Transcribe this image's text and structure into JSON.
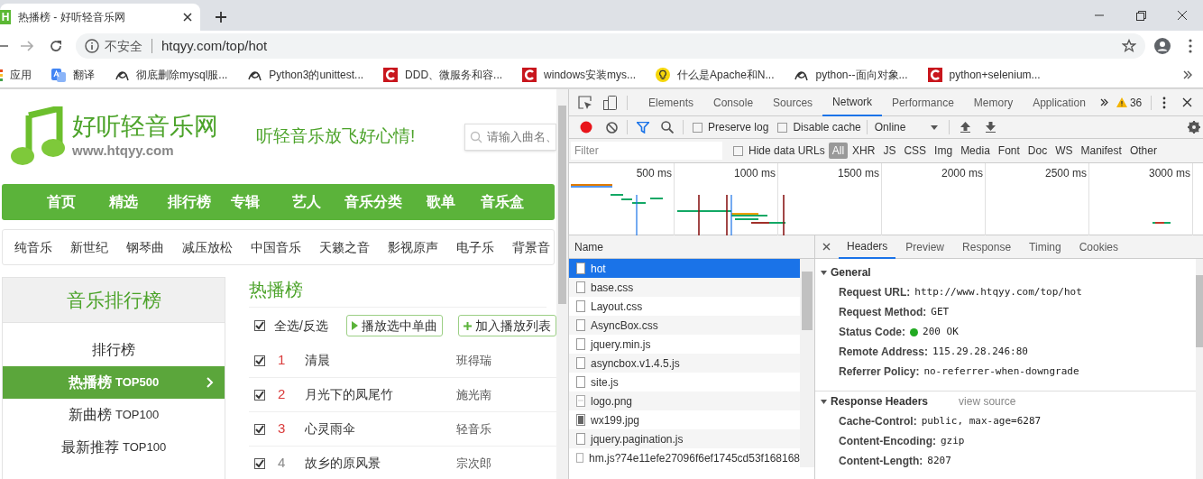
{
  "browser": {
    "tab": {
      "favicon": "H",
      "title": "热播榜 - 好听轻音乐网"
    },
    "address": {
      "security": "不安全",
      "url": "htqyy.com/top/hot"
    },
    "bookmarks": [
      {
        "kind": "apps",
        "label": "应用"
      },
      {
        "kind": "translate",
        "label": "翻译"
      },
      {
        "kind": "fish",
        "label": "彻底删除mysql服..."
      },
      {
        "kind": "fish",
        "label": "Python3的unittest..."
      },
      {
        "kind": "csdn",
        "label": "DDD、微服务和容..."
      },
      {
        "kind": "csdn",
        "label": "windows安装mys..."
      },
      {
        "kind": "bulb",
        "label": "什么是Apache和N..."
      },
      {
        "kind": "fish",
        "label": "python--面向对象..."
      },
      {
        "kind": "csdn",
        "label": "python+selenium..."
      }
    ]
  },
  "page": {
    "site_name": "好听轻音乐网",
    "domain": "www.htqyy.com",
    "slogan": "听轻音乐放飞好心情!",
    "search_placeholder": "请输入曲名、",
    "nav": [
      "首页",
      "精选",
      "排行榜",
      "专辑",
      "艺人",
      "音乐分类",
      "歌单",
      "音乐盒"
    ],
    "subnav": [
      "纯音乐",
      "新世纪",
      "钢琴曲",
      "减压放松",
      "中国音乐",
      "天籁之音",
      "影视原声",
      "电子乐",
      "背景音"
    ],
    "sidebar": {
      "title": "音乐排行榜",
      "items": [
        {
          "label": "排行榜",
          "selected": false
        },
        {
          "label": "热播榜",
          "suffix": "TOP500",
          "selected": true
        },
        {
          "label": "新曲榜",
          "suffix": "TOP100",
          "selected": false
        },
        {
          "label": "最新推荐",
          "suffix": "TOP100",
          "selected": false
        }
      ]
    },
    "content": {
      "heading": "热播榜",
      "select_all": {
        "label": "全选/反选",
        "checked": true
      },
      "buttons": [
        {
          "kind": "play",
          "label": "播放选中单曲"
        },
        {
          "kind": "add",
          "label": "加入播放列表"
        }
      ],
      "songs": [
        {
          "num": "1",
          "color": "#d93a3a",
          "title": "清晨",
          "artist": "班得瑞",
          "checked": true
        },
        {
          "num": "2",
          "color": "#d93a3a",
          "title": "月光下的凤尾竹",
          "artist": "施光南",
          "checked": true
        },
        {
          "num": "3",
          "color": "#d93a3a",
          "title": "心灵雨伞",
          "artist": "轻音乐",
          "checked": true
        },
        {
          "num": "4",
          "color": "#888888",
          "title": "故乡的原风景",
          "artist": "宗次郎",
          "checked": true
        }
      ]
    }
  },
  "devtools": {
    "tabs": [
      {
        "label": "Elements",
        "selected": false
      },
      {
        "label": "Console",
        "selected": false
      },
      {
        "label": "Sources",
        "selected": false
      },
      {
        "label": "Network",
        "selected": true
      },
      {
        "label": "Performance",
        "selected": false
      },
      {
        "label": "Memory",
        "selected": false
      },
      {
        "label": "Application",
        "selected": false
      }
    ],
    "warnings": "36",
    "toolbar": {
      "recording": true,
      "preserve_log": {
        "label": "Preserve log",
        "checked": false
      },
      "disable_cache": {
        "label": "Disable cache",
        "checked": false
      },
      "throttling": "Online"
    },
    "filter": {
      "placeholder": "Filter",
      "hide_data_urls": {
        "label": "Hide data URLs",
        "checked": false
      },
      "types": [
        {
          "label": "All",
          "selected": true
        },
        {
          "label": "XHR",
          "selected": false
        },
        {
          "label": "JS",
          "selected": false
        },
        {
          "label": "CSS",
          "selected": false
        },
        {
          "label": "Img",
          "selected": false
        },
        {
          "label": "Media",
          "selected": false
        },
        {
          "label": "Font",
          "selected": false
        },
        {
          "label": "Doc",
          "selected": false
        },
        {
          "label": "WS",
          "selected": false
        },
        {
          "label": "Manifest",
          "selected": false
        },
        {
          "label": "Other",
          "selected": false
        }
      ]
    },
    "timeline_ticks": [
      "500 ms",
      "1000 ms",
      "1500 ms",
      "2000 ms",
      "2500 ms",
      "3000 ms"
    ],
    "requests": {
      "column": "Name",
      "items": [
        {
          "name": "hot",
          "kind": "doc",
          "selected": true
        },
        {
          "name": "base.css",
          "kind": "doc",
          "selected": false
        },
        {
          "name": "Layout.css",
          "kind": "doc",
          "selected": false
        },
        {
          "name": "AsyncBox.css",
          "kind": "doc",
          "selected": false
        },
        {
          "name": "jquery.min.js",
          "kind": "doc",
          "selected": false
        },
        {
          "name": "asyncbox.v1.4.5.js",
          "kind": "doc",
          "selected": false
        },
        {
          "name": "site.js",
          "kind": "doc",
          "selected": false
        },
        {
          "name": "logo.png",
          "kind": "image",
          "selected": false
        },
        {
          "name": "wx199.jpg",
          "kind": "photo",
          "selected": false
        },
        {
          "name": "jquery.pagination.js",
          "kind": "doc",
          "selected": false
        },
        {
          "name": "hm.js?74e11efe27096f6ef1745cd53f168168",
          "kind": "doc",
          "selected": false
        }
      ]
    },
    "detail_tabs": [
      {
        "label": "Headers",
        "selected": true
      },
      {
        "label": "Preview",
        "selected": false
      },
      {
        "label": "Response",
        "selected": false
      },
      {
        "label": "Timing",
        "selected": false
      },
      {
        "label": "Cookies",
        "selected": false
      }
    ],
    "general": {
      "title": "General",
      "expanded": true,
      "rows": [
        {
          "key": "Request URL:",
          "value": "http://www.htqyy.com/top/hot"
        },
        {
          "key": "Request Method:",
          "value": "GET"
        },
        {
          "key": "Status Code:",
          "value": "200 OK",
          "color": "#22aa22"
        },
        {
          "key": "Remote Address:",
          "value": "115.29.28.246:80"
        },
        {
          "key": "Referrer Policy:",
          "value": "no-referrer-when-downgrade"
        }
      ]
    },
    "response_headers": {
      "title": "Response Headers",
      "expanded": true,
      "link": "view source",
      "rows": [
        {
          "key": "Cache-Control:",
          "value": "public, max-age=6287"
        },
        {
          "key": "Content-Encoding:",
          "value": "gzip"
        },
        {
          "key": "Content-Length:",
          "value": "8207"
        }
      ]
    }
  }
}
